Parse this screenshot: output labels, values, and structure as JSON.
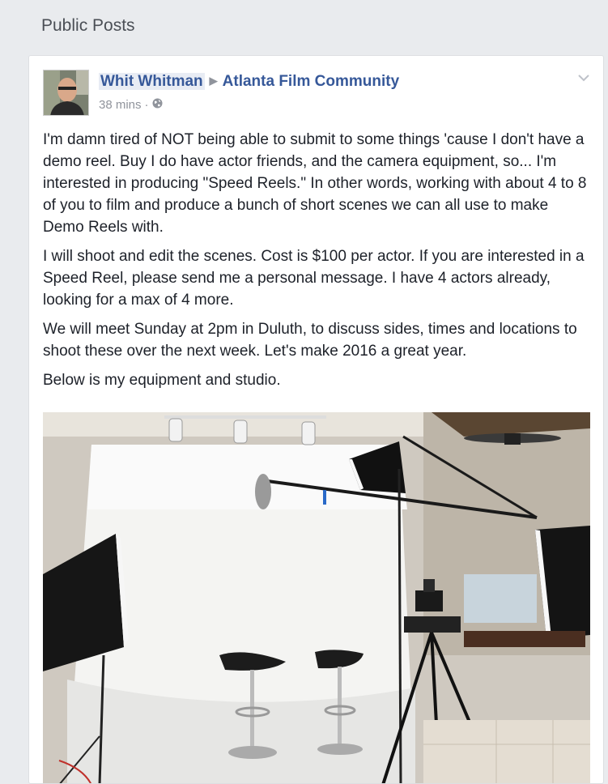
{
  "section": {
    "title": "Public Posts"
  },
  "post": {
    "author": "Whit Whitman",
    "group": "Atlanta Film Community",
    "time": "38 mins",
    "separator": "·",
    "audience_icon": "globe-icon",
    "menu_icon": "chevron-down-icon",
    "paragraphs": [
      "I'm damn tired of NOT being able to submit to some things 'cause I don't have a demo reel. Buy I do have actor friends, and the camera equipment, so... I'm interested in producing \"Speed Reels.\" In other words, working with about 4 to 8 of you to film and produce a bunch of short scenes we can all use to make Demo Reels with.",
      "I will shoot and edit the scenes. Cost is $100 per actor. If you are interested in a Speed Reel, please send me a personal message. I have 4 actors already, looking for a max of 4 more.",
      "We will meet Sunday at 2pm in Duluth, to discuss sides, times and locations to shoot these over the next week. Let's make 2016 a great year.",
      "Below is my equipment and studio."
    ]
  },
  "colors": {
    "page_bg": "#e9ebee",
    "link": "#365899",
    "text": "#1d2129",
    "meta": "#90949c"
  }
}
